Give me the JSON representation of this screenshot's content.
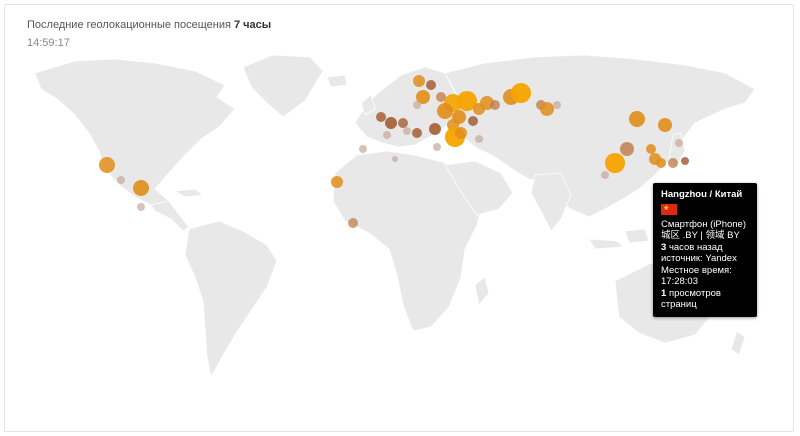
{
  "header": {
    "label": "Последние геолокационные посещения",
    "period": "7 часы",
    "time": "14:59:17"
  },
  "tooltip": {
    "location": "Hangzhou / Китай",
    "flag_icon": "china-flag-icon",
    "device": "Смартфон (iPhone)",
    "region": "城区 .BY | 领域 BY",
    "ago_count": "3",
    "ago_text": "часов назад",
    "source": "источник: Yandex",
    "local_time_label": "Местное время:",
    "local_time": "17:28:03",
    "pageviews_count": "1",
    "pageviews_text": "просмотров страниц"
  },
  "colors": {
    "land": "#e8e8e8",
    "border": "#ffffff",
    "dot_orange": "#f5a300",
    "dot_amber": "#e08d1a",
    "dot_brown": "#a0552a",
    "dot_faded": "#c8a898"
  }
}
